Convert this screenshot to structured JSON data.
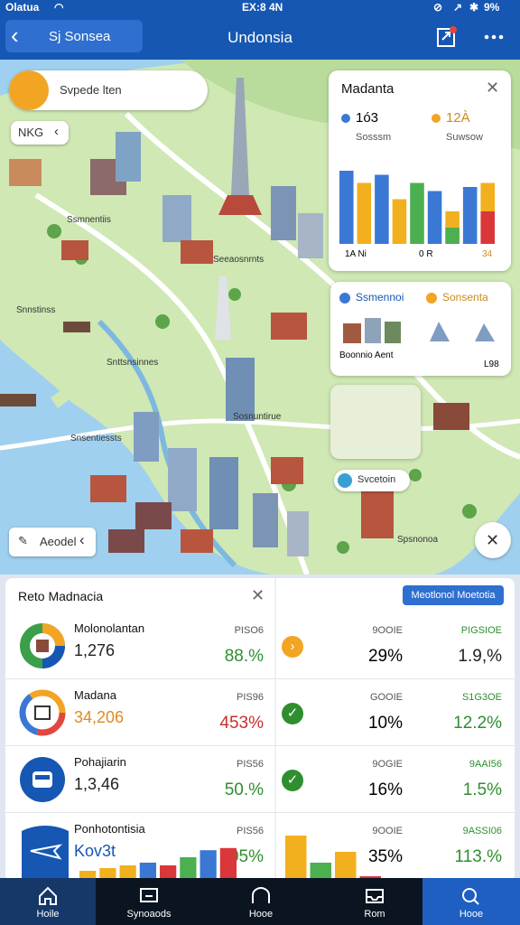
{
  "status_bar": {
    "carrier": "Olatua",
    "time": "EX:8 4N",
    "battery": "9%"
  },
  "app_bar": {
    "back_label": "Sj Sonsea",
    "title": "Undonsia"
  },
  "map": {
    "search_chip": "Svpede lten",
    "toggle_chip": "NKG",
    "legend_chip": "Aeodel",
    "labels": [
      "Ssmnentiis",
      "Seeaosnrnts",
      "Snnstinss",
      "Snttsnsinnes",
      "Snsentiessts",
      "Sosnuntirue",
      "Spsnonoa"
    ],
    "stats_card": {
      "title": "Madanta",
      "stat1": {
        "value": "1ó3",
        "sub": "Sosssm"
      },
      "stat2": {
        "value": "12À",
        "sub": "Suwsow"
      },
      "axis_left": "1A Ni",
      "axis_mid": "0 R",
      "axis_right": "34"
    },
    "places_card": {
      "tab1": "Ssmennoi",
      "tab2": "Sonsenta",
      "caption": "Boonnio Aent",
      "count": "L98"
    },
    "pin_label": "Svcetoin"
  },
  "sheet": {
    "title": "Reto Madnacia",
    "action": "Meotlonol Moetotia",
    "rows": [
      {
        "name": "Molonolantan",
        "value": "1,276",
        "l1": "PISO6",
        "p1": "88.%",
        "p1_color": "#2f8e2f",
        "status": "warning",
        "m1": "9OOIE",
        "m2": "29%",
        "r1": "PIGSIOE",
        "r2": "1.9,%",
        "icon": "gauge",
        "val_color": "#222"
      },
      {
        "name": "Madana",
        "value": "34,206",
        "l1": "PIS96",
        "p1": "453%",
        "p1_color": "#c9302c",
        "status": "ok",
        "m1": "GOOIE",
        "m2": "10%",
        "r1": "S1G3OE",
        "r2": "12.2%",
        "icon": "ring",
        "val_color": "#e08a1e"
      },
      {
        "name": "Pohajiarin",
        "value": "1,3,46",
        "l1": "PIS56",
        "p1": "50.%",
        "p1_color": "#2f8e2f",
        "status": "ok",
        "m1": "9OGIE",
        "m2": "16%",
        "r1": "9AAI56",
        "r2": "1.5%",
        "icon": "bus",
        "val_color": "#222"
      },
      {
        "name": "Ponhotontisia",
        "value": "Kov3t",
        "l1": "PIS56",
        "p1": "05%",
        "p1_color": "#2f8e2f",
        "status": "none",
        "m1": "9OOIE",
        "m2": "35%",
        "r1": "9ASSI06",
        "r2": "113.%",
        "icon": "plane",
        "val_color": "#1557b3"
      }
    ]
  },
  "row4_chart": {
    "values": [
      30,
      35,
      40,
      45,
      40,
      55,
      68,
      72
    ],
    "colors": [
      "#f2b01e",
      "#f2b01e",
      "#f2b01e",
      "#3a78d4",
      "#d9373a",
      "#4caf50",
      "#3a78d4",
      "#d9373a"
    ]
  },
  "row4_right_chart": {
    "values": [
      95,
      45,
      65,
      20
    ],
    "colors": [
      "#f2b01e",
      "#4caf50",
      "#f2b01e",
      "#d9373a"
    ]
  },
  "map_bar_chart": {
    "values": [
      90,
      75,
      85,
      55,
      75,
      65,
      40,
      70,
      75
    ],
    "colors": [
      "#3a78d4",
      "#f2b01e",
      "#3a78d4",
      "#f2b01e",
      "#4caf50",
      "#3a78d4",
      "#f2b01e",
      "#3a78d4",
      "#f2b01e"
    ],
    "lower": [
      0,
      0,
      0,
      0,
      0,
      0,
      20,
      0,
      40
    ],
    "lower_colors": [
      "#4caf50",
      "#4caf50",
      "#4caf50",
      "#4caf50",
      "#4caf50",
      "#4caf50",
      "#4caf50",
      "#4caf50",
      "#d9373a"
    ]
  },
  "bottom_nav": [
    {
      "label": "Hoile",
      "icon": "home-icon",
      "active": true
    },
    {
      "label": "Synoaods",
      "icon": "chat-icon",
      "active": false
    },
    {
      "label": "Hooe",
      "icon": "home-outline-icon",
      "active": false
    },
    {
      "label": "Rom",
      "icon": "inbox-icon",
      "active": false
    },
    {
      "label": "Hooe",
      "icon": "search-icon",
      "active": true
    }
  ],
  "colors": {
    "primary": "#1557b3",
    "water": "#9fd0ef",
    "land": "#cfe8b4",
    "accent_green": "#2f8e2f",
    "accent_red": "#c9302c"
  }
}
